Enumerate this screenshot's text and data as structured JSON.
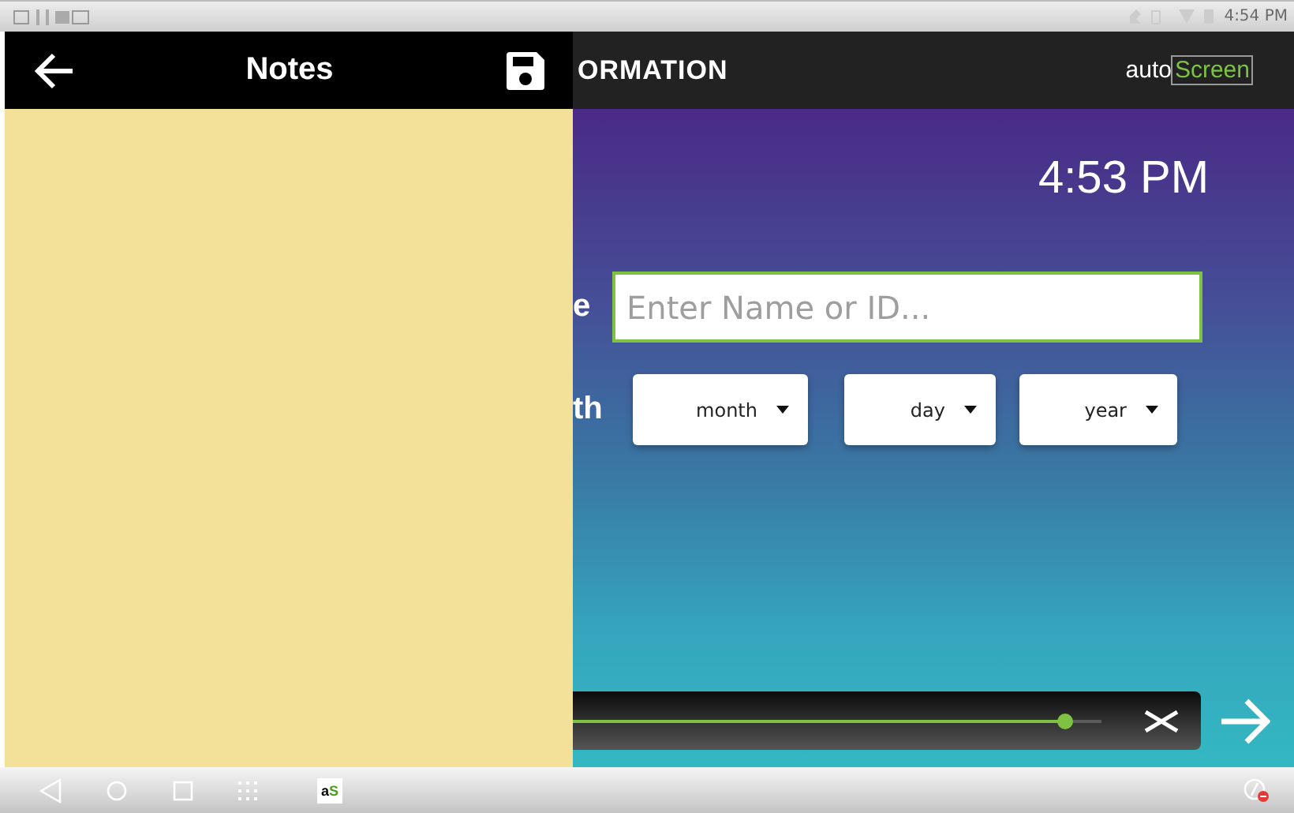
{
  "status_bar": {
    "time": "4:54 PM"
  },
  "notes": {
    "title": "Notes"
  },
  "app_bar": {
    "title": "ORMATION",
    "logo": {
      "prefix": "auto",
      "suffix": "Screen"
    }
  },
  "clock": "4:53 PM",
  "form": {
    "name_label": "e",
    "name_field": {
      "placeholder": "Enter Name or ID..."
    },
    "birth_label": "th",
    "dropdowns": [
      {
        "label": "month"
      },
      {
        "label": "day"
      },
      {
        "label": "year"
      }
    ]
  },
  "player": {
    "level": 0.93
  },
  "nav_bar": {
    "app_icon": {
      "prefix": "a",
      "suffix": "S"
    }
  }
}
